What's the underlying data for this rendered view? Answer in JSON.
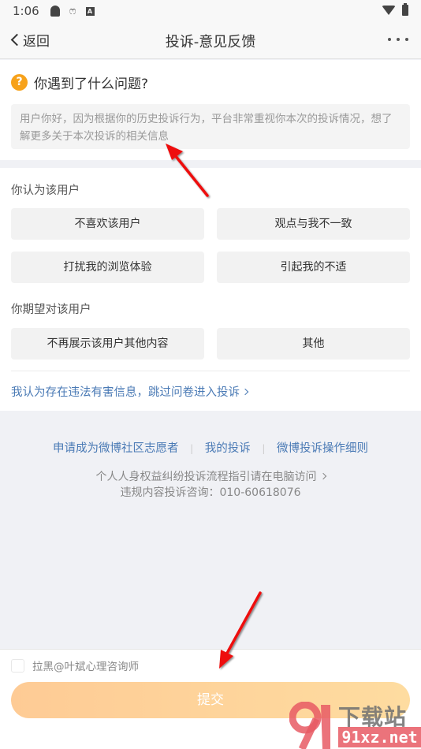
{
  "status_bar": {
    "time": "1:06",
    "left_icons": [
      "qq-notification-icon",
      "weibo-notification-icon",
      "a-notification-icon"
    ],
    "right_icons": [
      "wifi-icon",
      "battery-charging-icon"
    ]
  },
  "nav": {
    "back_label": "返回",
    "title": "投诉-意见反馈",
    "more_icon": "more-icon"
  },
  "question": {
    "icon": "?",
    "title": "你遇到了什么问题?",
    "description": "用户你好，因为根据你的历史投诉行为，平台非常重视你本次的投诉情况，想了解更多关于本次投诉的相关信息"
  },
  "options": {
    "group1_label": "你认为该用户",
    "group1": [
      "不喜欢该用户",
      "观点与我不一致",
      "打扰我的浏览体验",
      "引起我的不适"
    ],
    "group2_label": "你期望对该用户",
    "group2": [
      "不再展示该用户其他内容",
      "其他"
    ],
    "skip_link": "我认为存在违法有害信息，跳过问卷进入投诉"
  },
  "footer": {
    "links": [
      "申请成为微博社区志愿者",
      "我的投诉",
      "微博投诉操作细则"
    ],
    "separator": "|",
    "guide": "个人人身权益纠纷投诉流程指引请在电脑访问",
    "hotline": "违规内容投诉咨询：010-60618076"
  },
  "bottom": {
    "block_label": "拉黑@叶斌心理咨询师",
    "block_checked": false,
    "submit_label": "提交"
  },
  "colors": {
    "accent_link": "#4a7ab5",
    "question_icon": "#f7a21b",
    "submit_gradient_start": "#fecb95",
    "submit_gradient_end": "#fedca0",
    "annotation_arrow": "#ee1111"
  },
  "watermark": {
    "logo_text": "下载站",
    "url": "91xz.net"
  }
}
